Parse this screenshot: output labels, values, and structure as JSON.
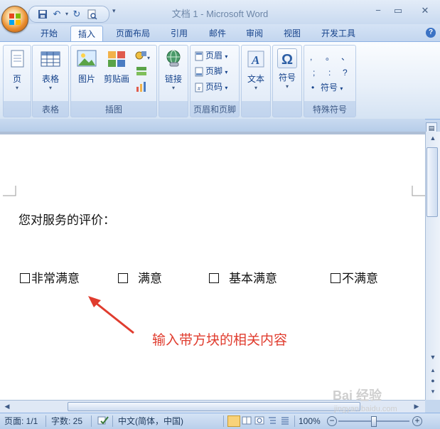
{
  "window": {
    "title": "文档 1 - Microsoft Word",
    "controls": [
      "minimize",
      "maximize",
      "close"
    ]
  },
  "tabs": [
    {
      "label": "开始",
      "active": false
    },
    {
      "label": "插入",
      "active": true
    },
    {
      "label": "页面布局",
      "active": false
    },
    {
      "label": "引用",
      "active": false
    },
    {
      "label": "邮件",
      "active": false
    },
    {
      "label": "审阅",
      "active": false
    },
    {
      "label": "视图",
      "active": false
    },
    {
      "label": "开发工具",
      "active": false
    }
  ],
  "ribbon": {
    "page": {
      "label": "页"
    },
    "table": {
      "button": "表格",
      "group": "表格"
    },
    "illustrations": {
      "picture": "图片",
      "clipart": "剪贴画",
      "group": "插图"
    },
    "link": {
      "label": "链接"
    },
    "header_footer": {
      "header": "页眉",
      "footer": "页脚",
      "page_number": "页码",
      "group": "页眉和页脚"
    },
    "text": {
      "label": "文本"
    },
    "symbol": {
      "label": "符号",
      "glyph": "Ω"
    },
    "special_symbols": {
      "row1": [
        ",",
        "。",
        "、"
      ],
      "row2": [
        ";",
        ":",
        "?"
      ],
      "bullet": "•",
      "symbol_btn": "符号",
      "group": "特殊符号"
    }
  },
  "document": {
    "question": "您对服务的评价：",
    "options": [
      "非常满意",
      "满意",
      "基本满意",
      "不满意"
    ],
    "annotation": "输入带方块的相关内容"
  },
  "statusbar": {
    "page": "页面: 1/1",
    "words": "字数: 25",
    "language": "中文(简体，中国)",
    "zoom": "100%"
  },
  "watermark": "Bai 经验\njingyan.baidu.com",
  "colors": {
    "accent": "#15428b",
    "annotation": "#e03c2e",
    "ribbon_border": "#8db2e3"
  }
}
